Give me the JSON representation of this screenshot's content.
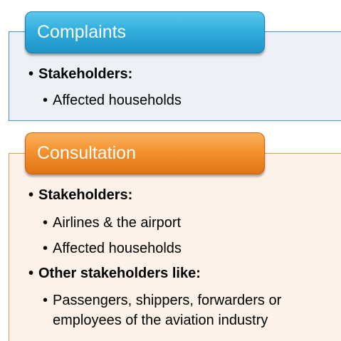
{
  "sections": [
    {
      "title": "Complaints",
      "items": [
        {
          "level": 1,
          "text": "Stakeholders:"
        },
        {
          "level": 2,
          "text": "Affected households"
        }
      ]
    },
    {
      "title": "Consultation",
      "items": [
        {
          "level": 1,
          "text": "Stakeholders:"
        },
        {
          "level": 2,
          "text": "Airlines & the airport"
        },
        {
          "level": 2,
          "text": "Affected households"
        },
        {
          "level": 1,
          "text": "Other stakeholders like:"
        },
        {
          "level": 2,
          "text": "Passengers, shippers, forwarders or"
        },
        {
          "level": 2,
          "text": "employees of the aviation industry",
          "continuation": true
        }
      ]
    }
  ],
  "bullet_glyph": "•",
  "colors": {
    "complaints_accent": "#31aede",
    "consultation_accent": "#f4922e",
    "complaints_panel": "#edf1f5",
    "consultation_panel": "#fdf2e9"
  }
}
